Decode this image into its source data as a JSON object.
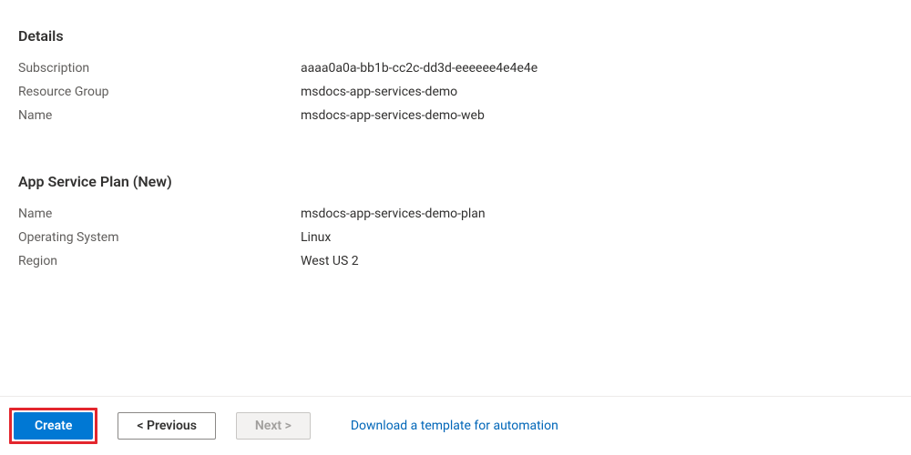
{
  "details": {
    "heading": "Details",
    "subscription_label": "Subscription",
    "subscription_value": "aaaa0a0a-bb1b-cc2c-dd3d-eeeeee4e4e4e",
    "resource_group_label": "Resource Group",
    "resource_group_value": "msdocs-app-services-demo",
    "name_label": "Name",
    "name_value": "msdocs-app-services-demo-web"
  },
  "plan": {
    "heading": "App Service Plan (New)",
    "name_label": "Name",
    "name_value": "msdocs-app-services-demo-plan",
    "os_label": "Operating System",
    "os_value": "Linux",
    "region_label": "Region",
    "region_value": "West US 2"
  },
  "footer": {
    "create_label": "Create",
    "previous_label": "< Previous",
    "next_label": "Next >",
    "download_link": "Download a template for automation"
  }
}
